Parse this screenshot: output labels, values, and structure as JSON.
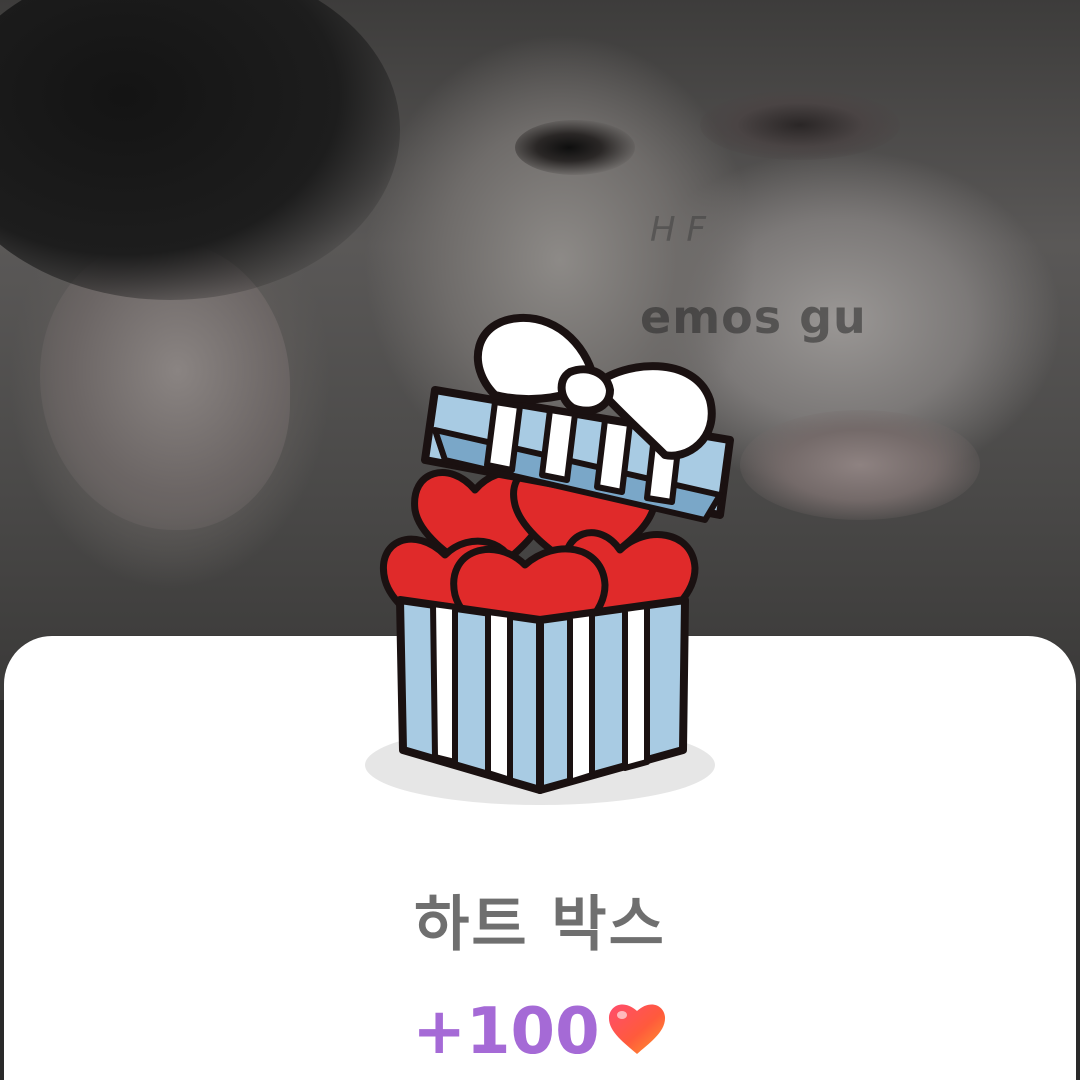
{
  "background": {
    "watermark_text": "emos gu",
    "watermark_small": "H F"
  },
  "reward_card": {
    "title": "하트 박스",
    "amount": "+100",
    "currency_icon": "heart-icon"
  },
  "colors": {
    "card_bg": "#ffffff",
    "title": "#6f6f6f",
    "amount": "#a56ad6",
    "box_blue": "#a8cbe3",
    "heart_red": "#e02a2a"
  }
}
